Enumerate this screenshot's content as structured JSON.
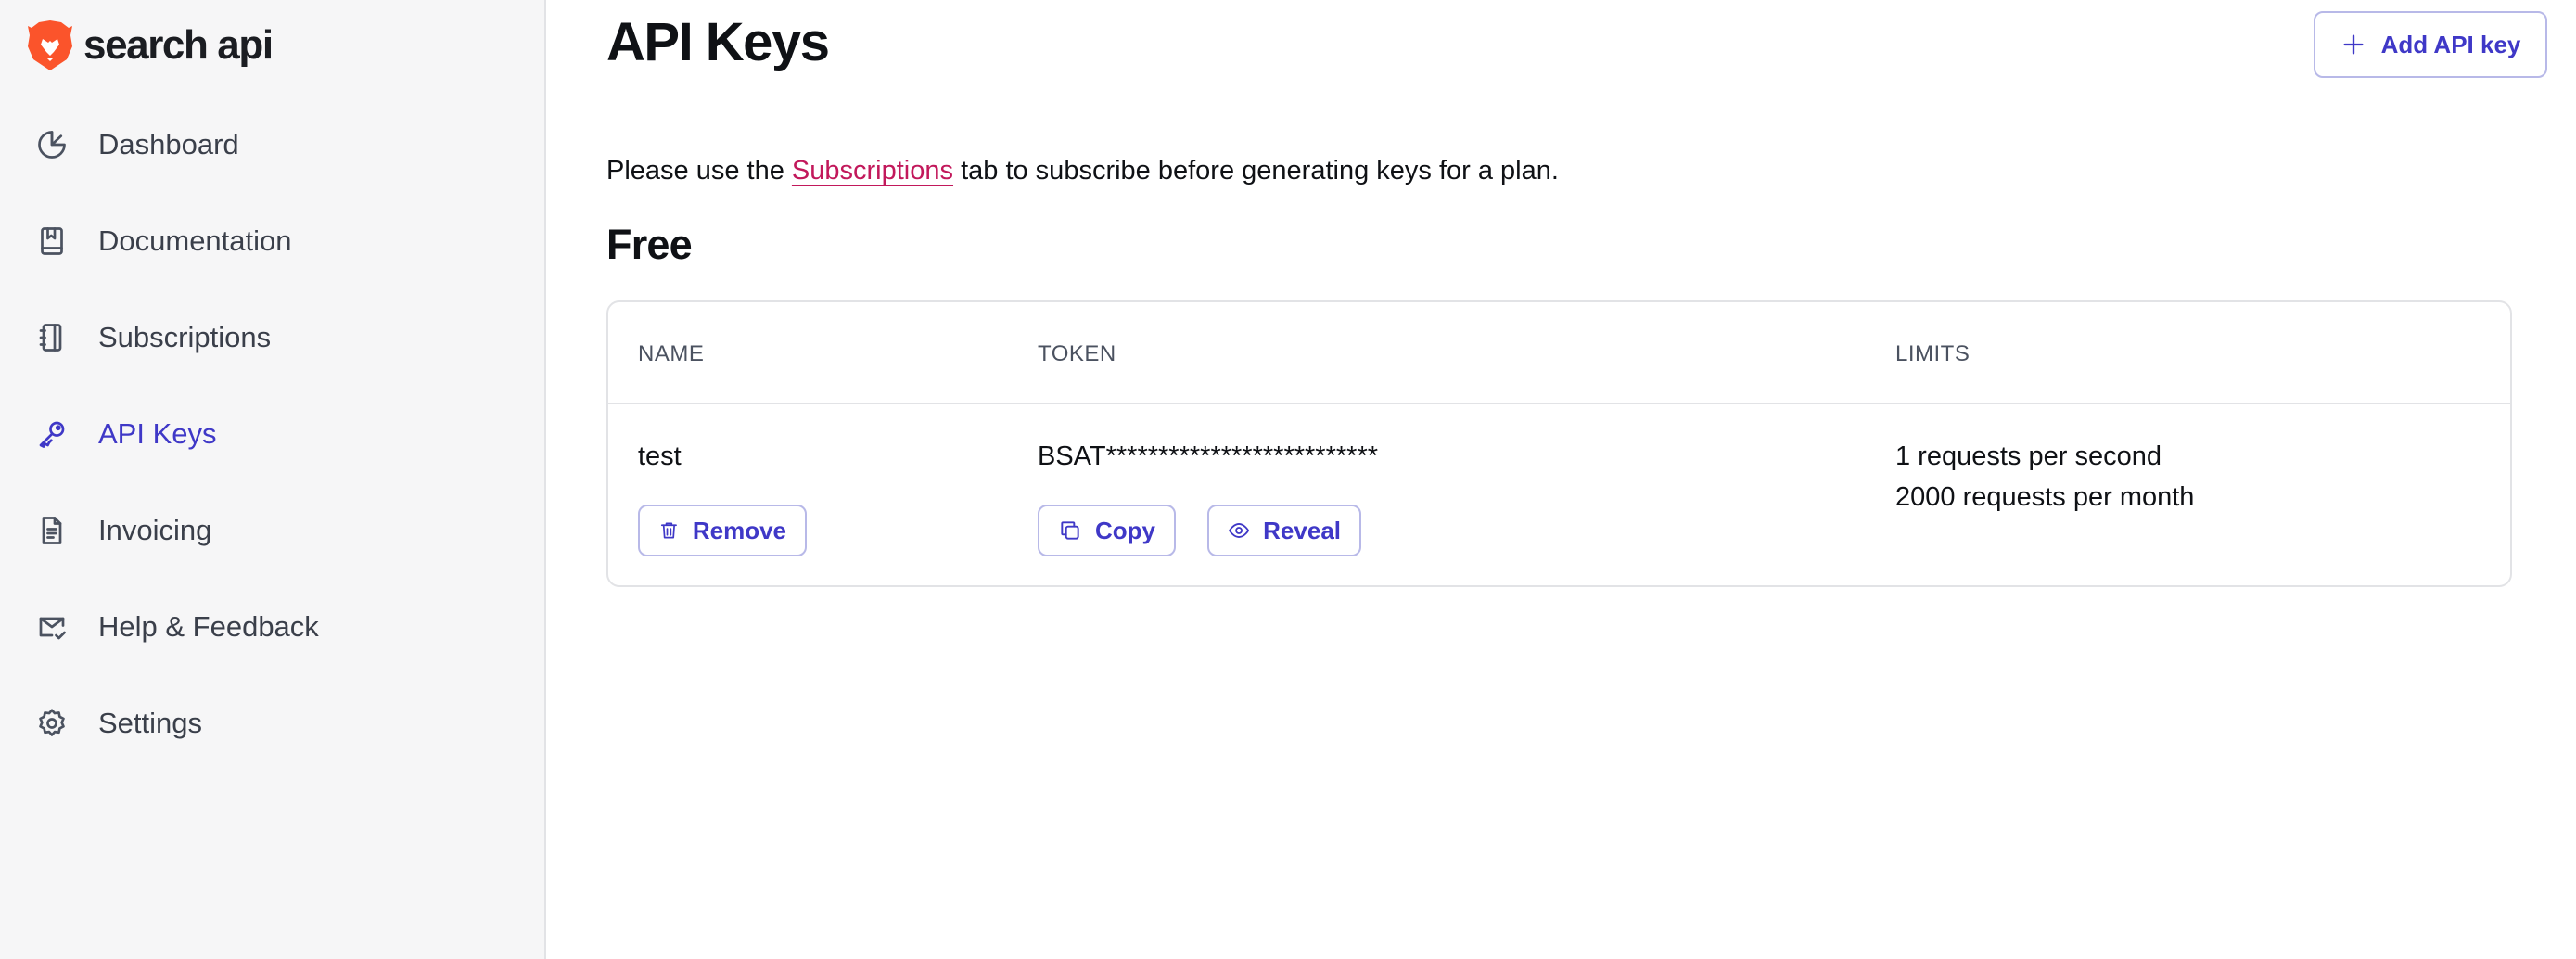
{
  "brand": {
    "name": "search api",
    "accent": "#3f38c7",
    "logo_color": "#fb542b"
  },
  "sidebar": {
    "items": [
      {
        "label": "Dashboard",
        "icon": "pie-chart-icon",
        "active": false
      },
      {
        "label": "Documentation",
        "icon": "book-icon",
        "active": false
      },
      {
        "label": "Subscriptions",
        "icon": "notebook-icon",
        "active": false
      },
      {
        "label": "API Keys",
        "icon": "key-icon",
        "active": true
      },
      {
        "label": "Invoicing",
        "icon": "document-icon",
        "active": false
      },
      {
        "label": "Help & Feedback",
        "icon": "mail-check-icon",
        "active": false
      },
      {
        "label": "Settings",
        "icon": "gear-icon",
        "active": false
      }
    ]
  },
  "header": {
    "title": "API Keys",
    "add_button_label": "Add API key"
  },
  "notice": {
    "prefix": "Please use the ",
    "link": "Subscriptions",
    "suffix": " tab to subscribe before generating keys for a plan."
  },
  "plan": {
    "title": "Free",
    "columns": {
      "name": "NAME",
      "token": "TOKEN",
      "limits": "LIMITS"
    },
    "rows": [
      {
        "name": "test",
        "token": "BSAT**************************",
        "limits": [
          "1 requests per second",
          "2000 requests per month"
        ],
        "remove_label": "Remove",
        "copy_label": "Copy",
        "reveal_label": "Reveal"
      }
    ]
  }
}
